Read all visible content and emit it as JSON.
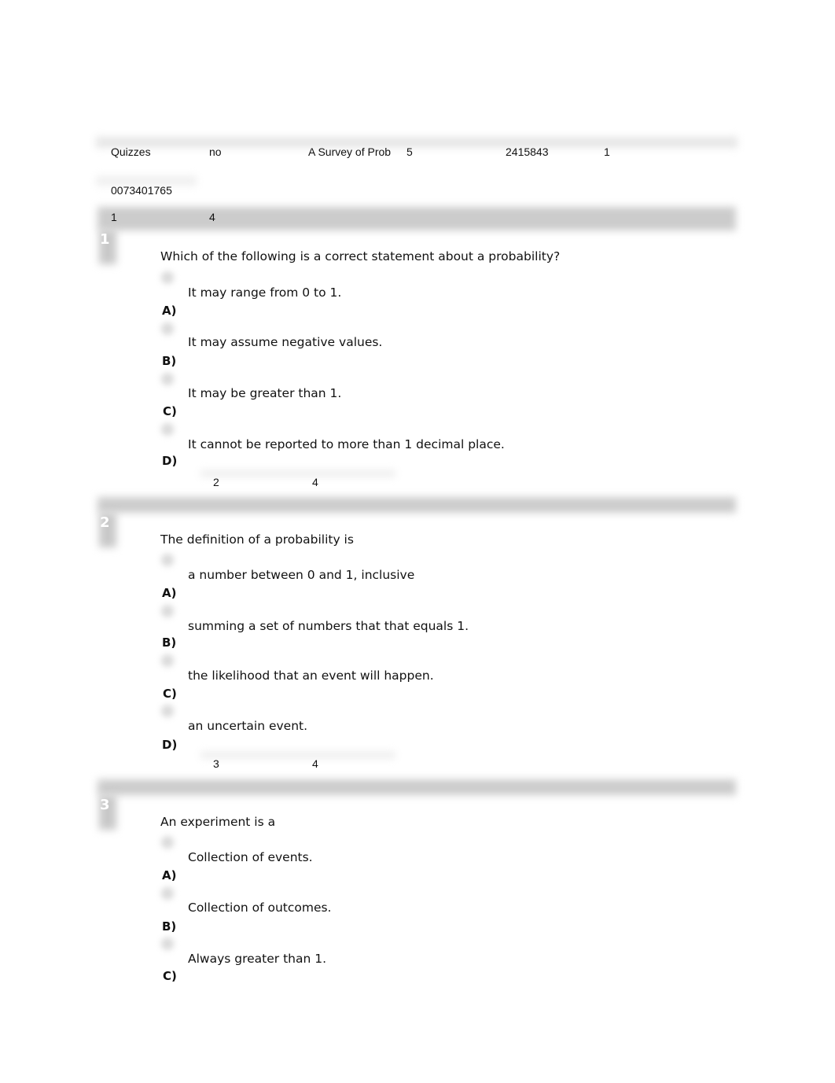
{
  "header": {
    "row1": [
      "Quizzes",
      "no",
      "A Survey of Prob",
      "5",
      "2415843",
      "1"
    ],
    "row2": [
      "0073401765"
    ],
    "row3": [
      "1",
      "4"
    ]
  },
  "questions": [
    {
      "number": "1",
      "text": "Which of the following is a correct statement about a probability?",
      "options": [
        {
          "label": "A)",
          "text": "It may range from 0 to 1."
        },
        {
          "label": "B)",
          "text": "It may assume negative values."
        },
        {
          "label": "C)",
          "text": "It may be greater than 1."
        },
        {
          "label": "D)",
          "text": "It cannot be reported to more than 1 decimal place."
        }
      ],
      "footer": [
        "2",
        "4"
      ]
    },
    {
      "number": "2",
      "text": "The definition of a probability is",
      "options": [
        {
          "label": "A)",
          "text": "a number between 0 and 1, inclusive"
        },
        {
          "label": "B)",
          "text": "summing a set of numbers that that equals 1."
        },
        {
          "label": "C)",
          "text": "the likelihood that an event will happen."
        },
        {
          "label": "D)",
          "text": "an uncertain event."
        }
      ],
      "footer": [
        "3",
        "4"
      ]
    },
    {
      "number": "3",
      "text": "An experiment is a",
      "options": [
        {
          "label": "A)",
          "text": "Collection of events."
        },
        {
          "label": "B)",
          "text": "Collection of outcomes."
        },
        {
          "label": "C)",
          "text": "Always greater than 1."
        }
      ]
    }
  ]
}
